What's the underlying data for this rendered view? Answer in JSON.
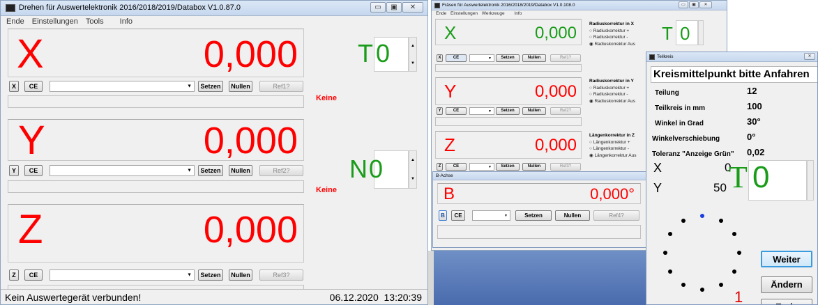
{
  "win1": {
    "title": "Drehen für Auswertelektronik 2016/2018/2019/Databox V1.0.87.0",
    "menu": [
      "Ende",
      "Einstellungen",
      "Tools",
      "Info"
    ],
    "axes": [
      {
        "label": "X",
        "value": "0,000",
        "btn_axis": "X",
        "ce": "CE",
        "setzen": "Setzen",
        "nullen": "Nullen",
        "ref": "Ref1?"
      },
      {
        "label": "Y",
        "value": "0,000",
        "btn_axis": "Y",
        "ce": "CE",
        "setzen": "Setzen",
        "nullen": "Nullen",
        "ref": "Ref2?"
      },
      {
        "label": "Z",
        "value": "0,000",
        "btn_axis": "Z",
        "ce": "CE",
        "setzen": "Setzen",
        "nullen": "Nullen",
        "ref": "Ref3?"
      }
    ],
    "keine": [
      "Keine",
      "Keine"
    ],
    "tool_letter": "T",
    "tool_value": "0",
    "n_letter": "N",
    "n_value": "0",
    "status": "Kein Auswertegerät verbunden!",
    "datetime": "06.12.2020  13:20:39"
  },
  "win2": {
    "title": "Fräsen für Auswertelektronik 2016/2018/2019/Databox  V1.0.108.0",
    "menu": [
      "Ende",
      "Einstellungen",
      "Werkzeuge",
      "Info"
    ],
    "axes": [
      {
        "label": "X",
        "value": "0,000",
        "btn_axis": "X",
        "ce": "CE",
        "setzen": "Setzen",
        "nullen": "Nullen",
        "ref": "Ref1?"
      },
      {
        "label": "Y",
        "value": "0,000",
        "btn_axis": "Y",
        "ce": "CE",
        "setzen": "Setzen",
        "nullen": "Nullen",
        "ref": "Ref2?"
      },
      {
        "label": "Z",
        "value": "0,000",
        "btn_axis": "Z",
        "ce": "CE",
        "setzen": "Setzen",
        "nullen": "Nullen",
        "ref": "Ref3?"
      }
    ],
    "groups": [
      {
        "title": "Radiuskorrektur in X",
        "options": [
          "Radiuskorrektur  +",
          "Radiuskorrektur  -",
          "Radiuskorrektur  Aus"
        ]
      },
      {
        "title": "Radiuskorrektur in Y",
        "options": [
          "Radiuskorrektur  +",
          "Radiuskorrektur  -",
          "Radiuskorrektur  Aus"
        ]
      },
      {
        "title": "Längenkorrektur in Z",
        "options": [
          "Längenkorrektur  +",
          "Längenkorrektur  -",
          "Längenkorrektur  Aus"
        ]
      }
    ],
    "tool_letter": "T",
    "tool_value": "0"
  },
  "bwin": {
    "title": "B-Achse",
    "label": "B",
    "value": "0,000°",
    "btn_axis": "B",
    "ce": "CE",
    "setzen": "Setzen",
    "nullen": "Nullen",
    "ref": "Ref4?"
  },
  "tk": {
    "title": "Teilkreis",
    "header": "Kreismittelpunkt bitte Anfahren",
    "rows": [
      {
        "label": "Teilung",
        "value": "12"
      },
      {
        "label": "Teilkreis in mm",
        "value": "100"
      },
      {
        "label": "Winkel in Grad",
        "value": "30°"
      },
      {
        "label": "Winkelverschiebung",
        "value": "0°"
      },
      {
        "label": "Toleranz \"Anzeige Grün\"",
        "value": "0,02"
      }
    ],
    "x_label": "X",
    "x_value": "0",
    "y_label": "Y",
    "y_value": "50",
    "t_letter": "T",
    "t_value": "0",
    "weiter": "Weiter",
    "aendern": "Ändern",
    "ende": "Ende",
    "counter": "1"
  }
}
